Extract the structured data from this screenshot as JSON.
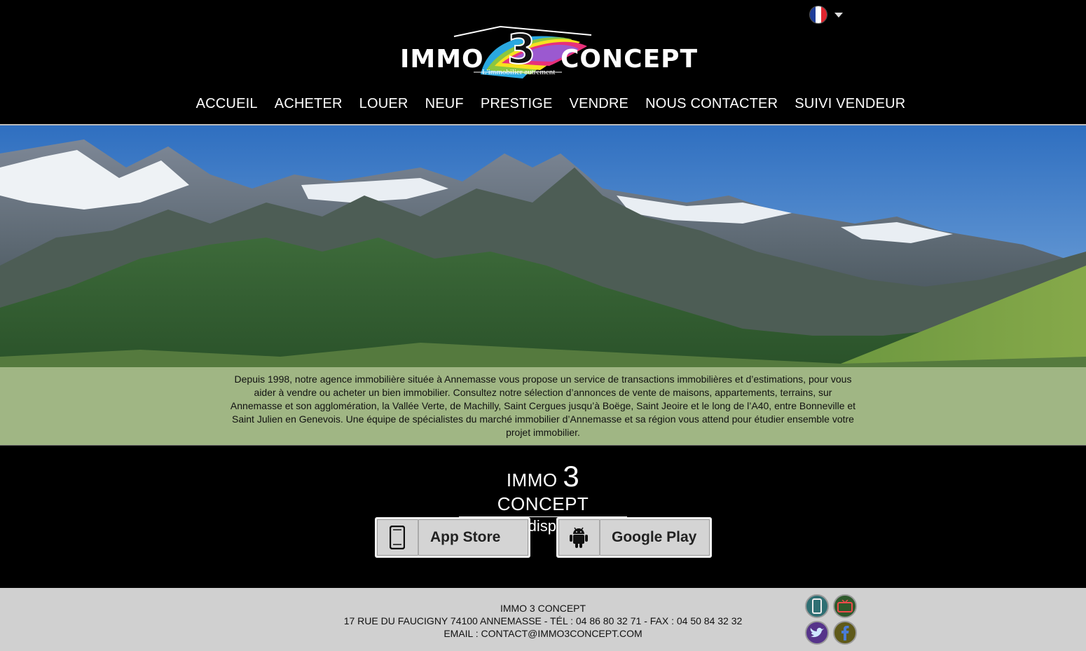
{
  "header": {
    "language": {
      "flag_colors": [
        "#1f3d99",
        "#ffffff",
        "#e0252f"
      ]
    },
    "logo": {
      "left_word": "IMMO",
      "number": "3",
      "right_word": "CONCEPT",
      "tagline": "L'immobilier autrement"
    },
    "nav": [
      {
        "label": "ACCUEIL"
      },
      {
        "label": "ACHETER"
      },
      {
        "label": "LOUER"
      },
      {
        "label": "NEUF"
      },
      {
        "label": "PRESTIGE"
      },
      {
        "label": "VENDRE"
      },
      {
        "label": "NOUS CONTACTER"
      },
      {
        "label": "SUIVI VENDEUR"
      }
    ]
  },
  "hero": {
    "description": "Depuis 1998, notre agence immobilière située à Annemasse vous propose un service de transactions immobilières et d’estimations, pour vous aider à vendre ou acheter un bien immobilier. Consultez notre sélection d’annonces de vente de maisons, appartements, terrains, sur Annemasse et son agglomération, la Vallée Verte, de Machilly, Saint Cergues jusqu’à Boëge, Saint Jeoire et le long de l’A40, entre Bonneville et Saint Julien en Genevois. Une équipe de spécialistes du marché immobilier d’Annemasse et sa région vous attend pour étudier ensemble votre projet immobilier."
  },
  "apps": {
    "brand_left": "IMMO ",
    "brand_num": "3",
    "brand_right": " CONCEPT",
    "subtitle": "est aussi disponible sur",
    "app_store_label": "App Store",
    "google_play_label": "Google Play"
  },
  "footer": {
    "company": "IMMO 3 CONCEPT",
    "address_line": "17 RUE DU FAUCIGNY 74100 ANNEMASSE  -  TÉL : 04 86 80 32 71 - FAX : 04 50 84 32 32",
    "email_line": "EMAIL : CONTACT@IMMO3CONCEPT.COM",
    "social_icons": [
      "mobile-icon",
      "tv-icon",
      "twitter-icon",
      "facebook-icon"
    ]
  }
}
